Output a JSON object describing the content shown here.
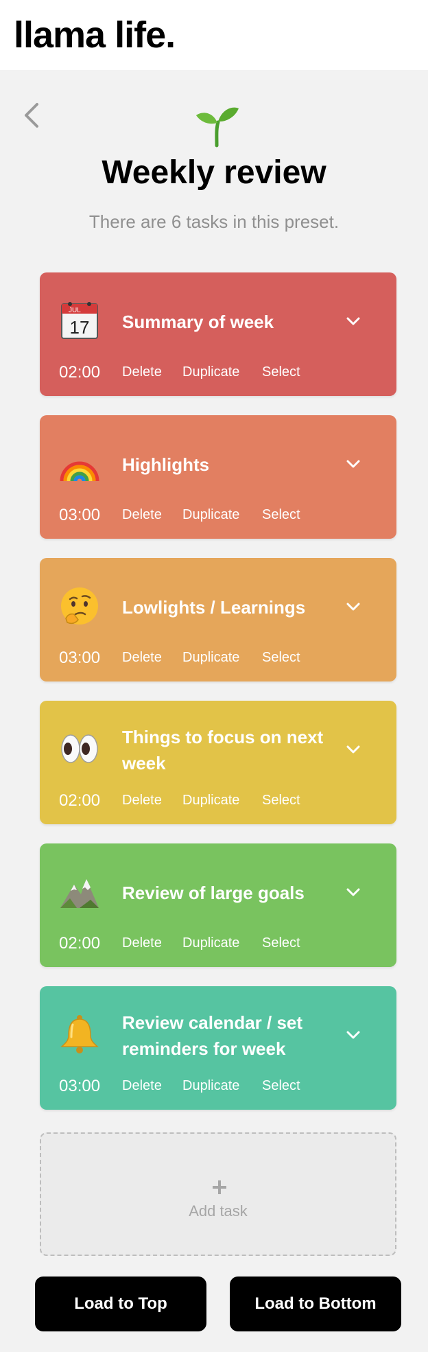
{
  "app": {
    "logo": "llama life."
  },
  "preset": {
    "title": "Weekly review",
    "subtitle": "There are 6 tasks in this preset."
  },
  "tasks": [
    {
      "name": "Summary of week",
      "time": "02:00",
      "color": "#d55f5c",
      "emoji": "calendar-icon",
      "calendar_month": "JUL",
      "calendar_day": "17"
    },
    {
      "name": "Highlights",
      "time": "03:00",
      "color": "#e27f61",
      "emoji": "rainbow-icon"
    },
    {
      "name": "Lowlights / Learnings",
      "time": "03:00",
      "color": "#e5a65a",
      "emoji": "thinking-face-icon"
    },
    {
      "name": "Things to focus on next week",
      "time": "02:00",
      "color": "#e2c348",
      "emoji": "eyes-icon"
    },
    {
      "name": "Review of large goals",
      "time": "02:00",
      "color": "#79c35f",
      "emoji": "mountain-icon"
    },
    {
      "name": "Review calendar / set reminders for week",
      "time": "03:00",
      "color": "#56c4a1",
      "emoji": "bell-icon"
    }
  ],
  "task_actions": {
    "delete": "Delete",
    "duplicate": "Duplicate",
    "select": "Select"
  },
  "add_task": {
    "label": "Add task"
  },
  "buttons": {
    "load_top": "Load to Top",
    "load_bottom": "Load to Bottom"
  }
}
